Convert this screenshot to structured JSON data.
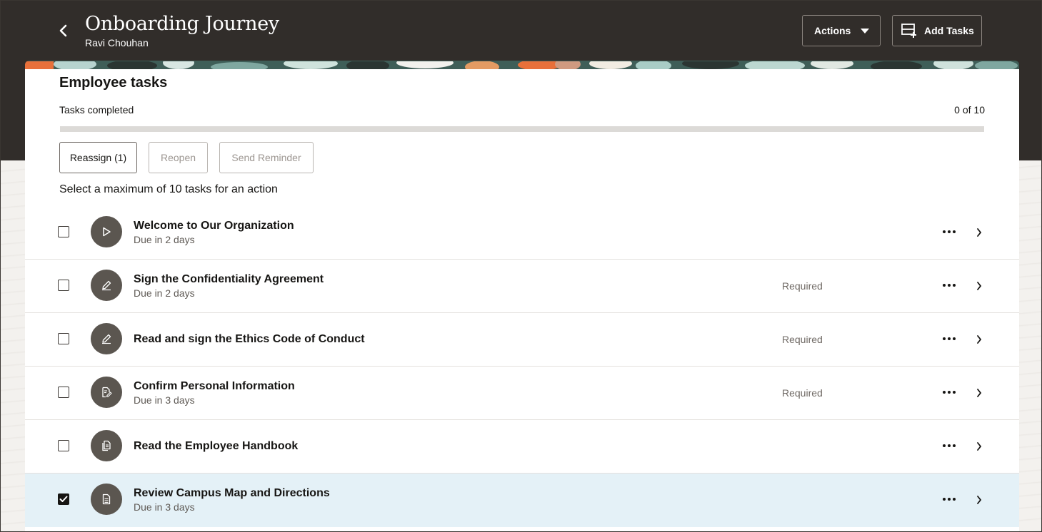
{
  "header": {
    "title": "Onboarding Journey",
    "subtitle": "Ravi Chouhan",
    "actions_label": "Actions",
    "add_tasks_label": "Add Tasks"
  },
  "card": {
    "title": "Employee tasks",
    "tasks_completed_label": "Tasks completed",
    "tasks_completed_count": "0 of 10",
    "progress_fraction": 0,
    "buttons": {
      "reassign": "Reassign (1)",
      "reopen": "Reopen",
      "send_reminder": "Send Reminder"
    },
    "helper_text": "Select a maximum of 10 tasks for an action"
  },
  "tasks": [
    {
      "name": "Welcome to Our Organization",
      "due": "Due in 2 days",
      "required": "",
      "icon": "play-icon",
      "checked": false
    },
    {
      "name": "Sign the Confidentiality Agreement",
      "due": "Due in 2 days",
      "required": "Required",
      "icon": "pen-icon",
      "checked": false
    },
    {
      "name": "Read and sign the Ethics Code of Conduct",
      "due": "",
      "required": "Required",
      "icon": "pen-icon",
      "checked": false
    },
    {
      "name": "Confirm Personal Information",
      "due": "Due in 3 days",
      "required": "Required",
      "icon": "document-edit-icon",
      "checked": false
    },
    {
      "name": "Read the Employee Handbook",
      "due": "",
      "required": "",
      "icon": "documents-icon",
      "checked": false
    },
    {
      "name": "Review Campus Map and Directions",
      "due": "Due in 3 days",
      "required": "",
      "icon": "document-icon",
      "checked": true
    }
  ],
  "colors": {
    "header_bg": "#312d2a",
    "selected_row_bg": "#e4f1f7",
    "icon_circle_bg": "#5b5650"
  }
}
